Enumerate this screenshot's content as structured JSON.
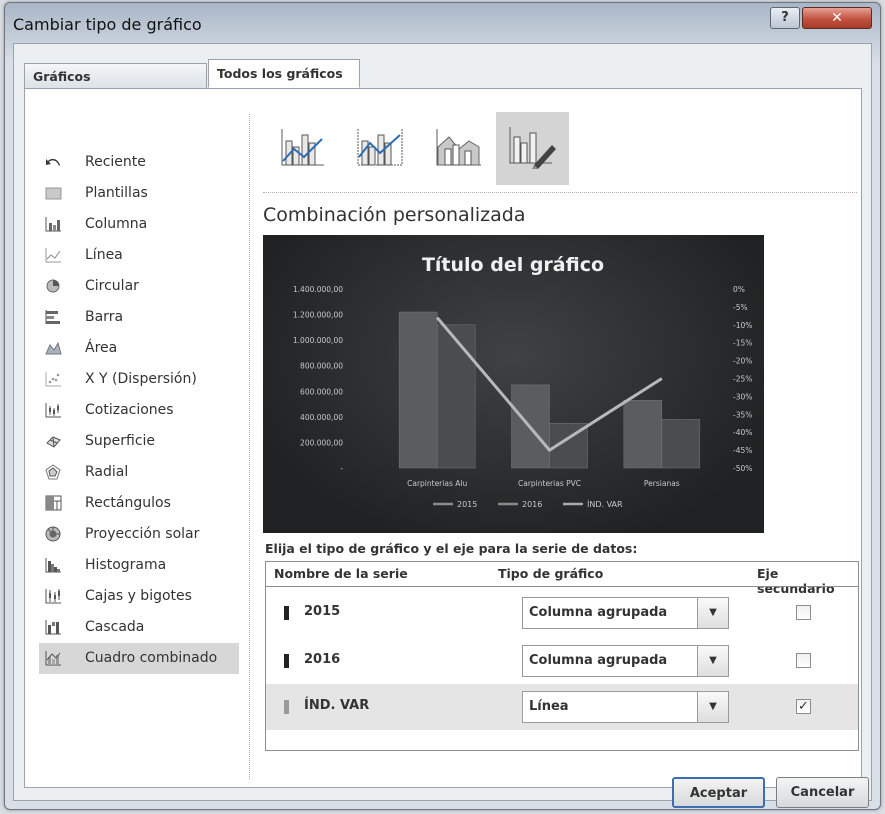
{
  "window": {
    "title": "Cambiar tipo de gráfico",
    "help_label": "?",
    "close_label": "✕"
  },
  "tabs": [
    {
      "label": "Gráficos recomendados",
      "active": false
    },
    {
      "label": "Todos los gráficos",
      "active": true
    }
  ],
  "sidebar": {
    "items": [
      {
        "label": "Reciente",
        "icon": "undo-arrow-icon"
      },
      {
        "label": "Plantillas",
        "icon": "folder-icon"
      },
      {
        "label": "Columna",
        "icon": "column-chart-icon"
      },
      {
        "label": "Línea",
        "icon": "line-chart-icon"
      },
      {
        "label": "Circular",
        "icon": "pie-chart-icon"
      },
      {
        "label": "Barra",
        "icon": "bar-chart-icon"
      },
      {
        "label": "Área",
        "icon": "area-chart-icon"
      },
      {
        "label": "X Y (Dispersión)",
        "icon": "scatter-chart-icon"
      },
      {
        "label": "Cotizaciones",
        "icon": "stock-chart-icon"
      },
      {
        "label": "Superficie",
        "icon": "surface-chart-icon"
      },
      {
        "label": "Radial",
        "icon": "radar-chart-icon"
      },
      {
        "label": "Rectángulos",
        "icon": "treemap-chart-icon"
      },
      {
        "label": "Proyección solar",
        "icon": "sunburst-chart-icon"
      },
      {
        "label": "Histograma",
        "icon": "histogram-chart-icon"
      },
      {
        "label": "Cajas y bigotes",
        "icon": "box-whisker-chart-icon"
      },
      {
        "label": "Cascada",
        "icon": "waterfall-chart-icon"
      },
      {
        "label": "Cuadro combinado",
        "icon": "combo-chart-icon",
        "selected": true
      }
    ]
  },
  "subtypes": [
    {
      "icon": "combo-column-line-icon",
      "selected": false
    },
    {
      "icon": "combo-column-line-secondary-icon",
      "selected": false
    },
    {
      "icon": "combo-area-column-icon",
      "selected": false
    },
    {
      "icon": "combo-custom-icon",
      "selected": true
    }
  ],
  "section_title": "Combinación personalizada",
  "chart_preview": {
    "background": "#2a2c2d",
    "chart_data": {
      "type": "bar",
      "title": "Título del gráfico",
      "categories": [
        "Carpinterias Alu",
        "Carpinterias PVC",
        "Persianas"
      ],
      "series": [
        {
          "name": "2015",
          "type": "bar",
          "axis": "primary",
          "values": [
            1220000,
            650000,
            530000
          ]
        },
        {
          "name": "2016",
          "type": "bar",
          "axis": "primary",
          "values": [
            1120000,
            350000,
            380000
          ]
        },
        {
          "name": "ÍND. VAR",
          "type": "line",
          "axis": "secondary",
          "values": [
            -8,
            -45,
            -25
          ]
        }
      ],
      "y_ticks": [
        "-",
        "200.000,00",
        "400.000,00",
        "600.000,00",
        "800.000,00",
        "1.000.000,00",
        "1.200.000,00",
        "1.400.000,00"
      ],
      "ylim": [
        0,
        1400000
      ],
      "y2_ticks": [
        "0%",
        "-5%",
        "-10%",
        "-15%",
        "-20%",
        "-25%",
        "-30%",
        "-35%",
        "-40%",
        "-45%",
        "-50%"
      ],
      "y2lim": [
        -50,
        0
      ],
      "x_tick_labels": [
        "Carpinterias Alu",
        "Carpinterias PVC",
        "Persianas"
      ],
      "legend": [
        "2015",
        "2016",
        "ÍND. VAR"
      ],
      "legend_position": "bottom",
      "grid": false
    }
  },
  "series_instruction": "Elija el tipo de gráfico y el eje para la serie de datos:",
  "series_table": {
    "headers": {
      "name": "Nombre de la serie",
      "type": "Tipo de gráfico",
      "secondary": "Eje secundario"
    },
    "rows": [
      {
        "name": "2015",
        "chart_type": "Columna agrupada",
        "secondary_axis": false,
        "secondary_mark": ""
      },
      {
        "name": "2016",
        "chart_type": "Columna agrupada",
        "secondary_axis": false,
        "secondary_mark": ""
      },
      {
        "name": "ÍND. VAR",
        "chart_type": "Línea",
        "secondary_axis": true,
        "secondary_mark": "✓"
      }
    ]
  },
  "buttons": {
    "ok": "Aceptar",
    "cancel": "Cancelar"
  }
}
